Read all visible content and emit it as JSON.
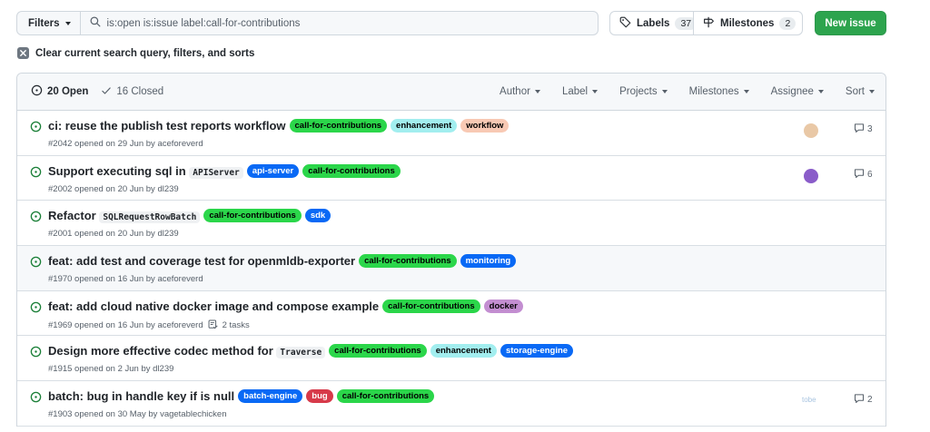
{
  "toolbar": {
    "filters_label": "Filters",
    "search_value": "is:open is:issue label:call-for-contributions",
    "labels_label": "Labels",
    "labels_count": "37",
    "milestones_label": "Milestones",
    "milestones_count": "2",
    "new_issue_label": "New issue"
  },
  "clear_text": "Clear current search query, filters, and sorts",
  "header": {
    "open_label": "20 Open",
    "closed_label": "16 Closed",
    "filters": [
      "Author",
      "Label",
      "Projects",
      "Milestones",
      "Assignee",
      "Sort"
    ]
  },
  "issues": [
    {
      "title": "ci: reuse the publish test reports workflow",
      "labels": [
        {
          "name": "call-for-contributions",
          "bg": "#2bd64a",
          "fg": "#000000"
        },
        {
          "name": "enhancement",
          "bg": "#a2eeef",
          "fg": "#000000"
        },
        {
          "name": "workflow",
          "bg": "#f8c9b4",
          "fg": "#000000"
        }
      ],
      "meta": "#2042 opened on 29 Jun by aceforeverd",
      "assignee_color": "#e9c8a6",
      "comments": "3"
    },
    {
      "title_before": "Support executing sql in ",
      "title_code": "APIServer",
      "labels": [
        {
          "name": "api-server",
          "bg": "#0969f5",
          "fg": "#ffffff"
        },
        {
          "name": "call-for-contributions",
          "bg": "#2bd64a",
          "fg": "#000000"
        }
      ],
      "meta": "#2002 opened on 20 Jun by dl239",
      "assignee_color": "#8a5cc9",
      "comments": "6"
    },
    {
      "title_before": "Refactor ",
      "title_code": "SQLRequestRowBatch",
      "labels": [
        {
          "name": "call-for-contributions",
          "bg": "#2bd64a",
          "fg": "#000000"
        },
        {
          "name": "sdk",
          "bg": "#0969f5",
          "fg": "#ffffff"
        }
      ],
      "meta": "#2001 opened on 20 Jun by dl239"
    },
    {
      "title": "feat: add test and coverage test for openmldb-exporter",
      "labels": [
        {
          "name": "call-for-contributions",
          "bg": "#2bd64a",
          "fg": "#000000"
        },
        {
          "name": "monitoring",
          "bg": "#0969f5",
          "fg": "#ffffff"
        }
      ],
      "meta": "#1970 opened on 16 Jun by aceforeverd"
    },
    {
      "title": "feat: add cloud native docker image and compose example",
      "labels": [
        {
          "name": "call-for-contributions",
          "bg": "#2bd64a",
          "fg": "#000000"
        },
        {
          "name": "docker",
          "bg": "#c38ed1",
          "fg": "#000000"
        }
      ],
      "meta": "#1969 opened on 16 Jun by aceforeverd",
      "tasks": "2 tasks"
    },
    {
      "title_before": "Design more effective codec method for ",
      "title_code": "Traverse",
      "labels": [
        {
          "name": "call-for-contributions",
          "bg": "#2bd64a",
          "fg": "#000000"
        },
        {
          "name": "enhancement",
          "bg": "#a2eeef",
          "fg": "#000000"
        },
        {
          "name": "storage-engine",
          "bg": "#0969f5",
          "fg": "#ffffff"
        }
      ],
      "meta": "#1915 opened on 2 Jun by dl239"
    },
    {
      "title": "batch: bug in handle key if is null",
      "labels": [
        {
          "name": "batch-engine",
          "bg": "#0969f5",
          "fg": "#ffffff"
        },
        {
          "name": "bug",
          "bg": "#d73a4a",
          "fg": "#ffffff"
        },
        {
          "name": "call-for-contributions",
          "bg": "#2bd64a",
          "fg": "#000000"
        }
      ],
      "meta": "#1903 opened on 30 May by vagetablechicken",
      "assignee_text": "tobe",
      "comments": "2"
    }
  ],
  "colors": {
    "open_green": "#1a7f37",
    "primary_button": "#2da44e"
  },
  "icons": {
    "search": "search-icon",
    "label": "tag-icon",
    "milestone": "milestone-icon",
    "clear": "x-icon",
    "open_issue": "issue-opened-icon",
    "check": "check-icon",
    "comment": "comment-icon",
    "tasks": "tasklist-icon"
  }
}
